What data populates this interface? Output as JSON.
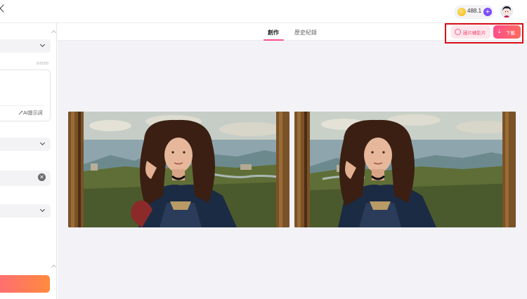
{
  "header": {
    "credits": "488.1",
    "add_credits_label": "+"
  },
  "sidebar": {
    "char_counter": "0/5000",
    "ai_prompt_label": "AI提示詞"
  },
  "main": {
    "tabs": [
      {
        "label": "創作",
        "active": true
      },
      {
        "label": "歷史紀錄",
        "active": false
      }
    ],
    "actions": {
      "image_to_video_label": "圖片轉影片",
      "download_label": "下載"
    },
    "results": [
      {
        "subject": "renaissance portrait of woman with long curly hair"
      },
      {
        "subject": "renaissance portrait of woman with long curly hair"
      }
    ]
  },
  "colors": {
    "accent_pink": "#ff4f8b",
    "accent_orange": "#ff8a3d",
    "highlight_red": "#d80e17",
    "purple": "#7b4dfa"
  },
  "icons": {
    "coin": "coin-icon",
    "plus": "plus-icon",
    "clear": "clear-icon",
    "download": "download-icon",
    "image_to_video": "image-to-video-icon"
  }
}
